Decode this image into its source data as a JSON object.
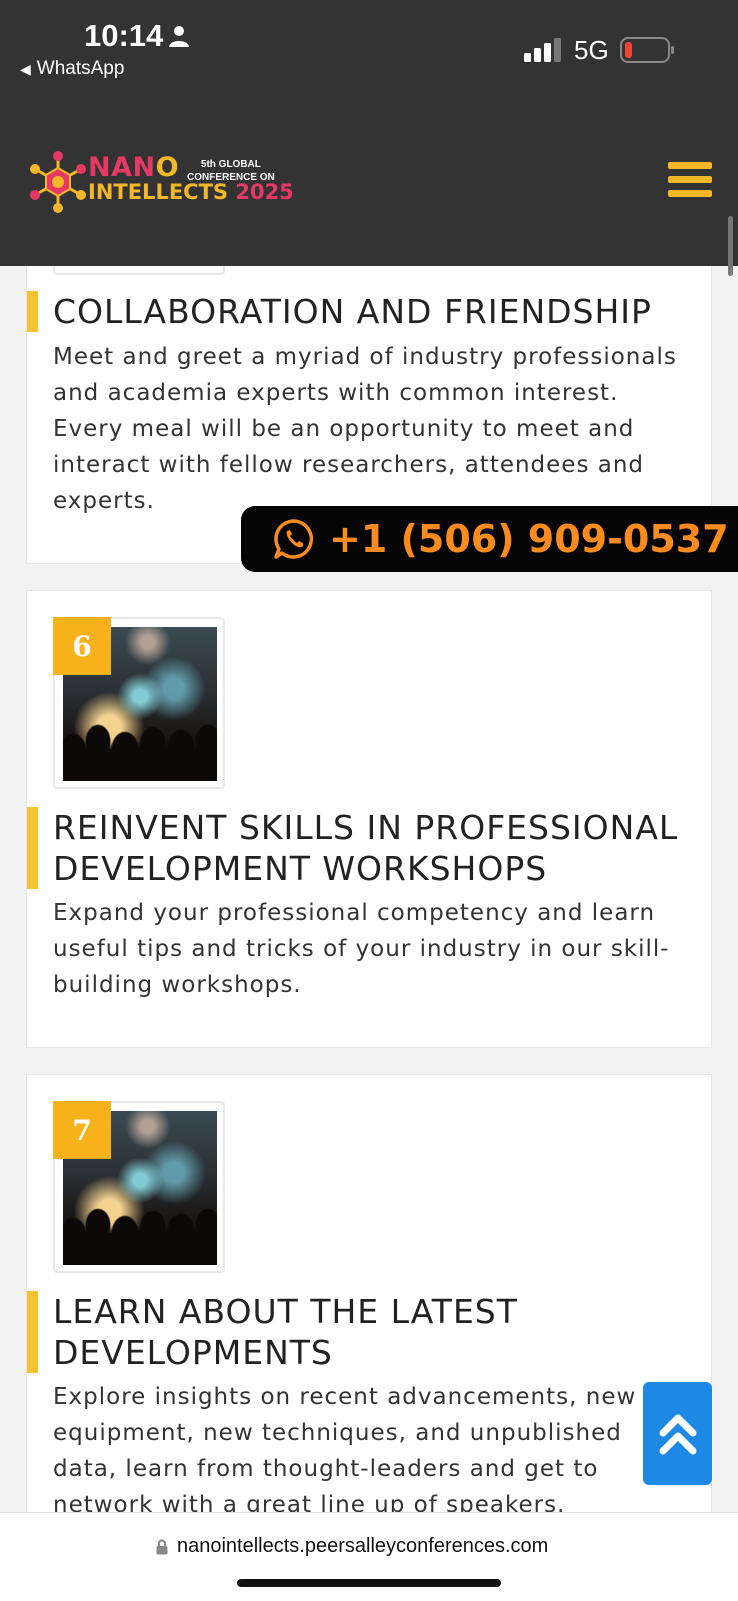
{
  "status": {
    "time": "10:14",
    "back_app": "WhatsApp",
    "network": "5G"
  },
  "header": {
    "logo_word1_a": "NAN",
    "logo_word1_b": "O",
    "logo_word2_a": "INTELLECTS ",
    "logo_word2_b": "2025",
    "logo_sub_line1": "5th GLOBAL",
    "logo_sub_line2": "CONFERENCE ON"
  },
  "cards": [
    {
      "title": "COLLABORATION AND FRIENDSHIP",
      "description": "Meet and greet a myriad of industry professionals and academia experts with common interest. Every meal will be an opportunity to meet and interact with fellow researchers, attendees and experts."
    },
    {
      "number": "6",
      "title": "REINVENT SKILLS IN PROFESSIONAL DEVELOPMENT WORKSHOPS",
      "description": "Expand your professional competency and learn useful tips and tricks of your industry in our skill-building workshops."
    },
    {
      "number": "7",
      "title": "LEARN ABOUT THE LATEST DEVELOPMENTS",
      "description": "Explore insights on recent advancements, new equipment, new techniques, and unpublished data, learn from thought-leaders and get to network with a great line up of speakers."
    }
  ],
  "whatsapp": {
    "phone": "+1 (506) 909-0537"
  },
  "browser": {
    "url": "nanointellects.peersalleyconferences.com"
  },
  "colors": {
    "header_bg": "#333333",
    "accent_yellow": "#f7c431",
    "brand_pink": "#e53965",
    "whatsapp_text": "#fb8b1e",
    "back_to_top": "#1e88e5"
  },
  "icons": [
    "person-icon",
    "signal-icon",
    "battery-icon",
    "hamburger-menu-icon",
    "whatsapp-icon",
    "chevrons-up-icon",
    "lock-icon"
  ]
}
